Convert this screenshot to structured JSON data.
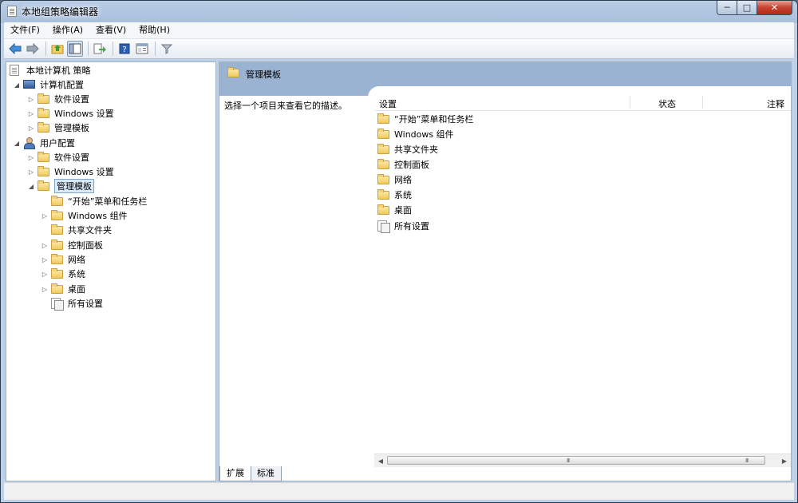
{
  "window": {
    "title": "本地组策略编辑器"
  },
  "menu": [
    "文件(F)",
    "操作(A)",
    "查看(V)",
    "帮助(H)"
  ],
  "toolbar": [
    "back-arrow-icon",
    "forward-arrow-icon",
    "up-folder-icon",
    "show-hide-tree-icon",
    "export-list-icon",
    "help-icon",
    "properties-icon",
    "filter-icon"
  ],
  "tree": {
    "root": "本地计算机 策略",
    "computer_config": "计算机配置",
    "computer_children": [
      "软件设置",
      "Windows 设置",
      "管理模板"
    ],
    "user_config": "用户配置",
    "user_children": [
      "软件设置",
      "Windows 设置",
      "管理模板"
    ],
    "admin_templates_children": [
      "“开始”菜单和任务栏",
      "Windows 组件",
      "共享文件夹",
      "控制面板",
      "网络",
      "系统",
      "桌面",
      "所有设置"
    ]
  },
  "right_pane": {
    "header_title": "管理模板",
    "description": "选择一个项目来查看它的描述。",
    "columns": {
      "setting": "设置",
      "status": "状态",
      "note": "注释"
    },
    "items": [
      "“开始”菜单和任务栏",
      "Windows 组件",
      "共享文件夹",
      "控制面板",
      "网络",
      "系统",
      "桌面",
      "所有设置"
    ]
  },
  "tabs": {
    "expand": "扩展",
    "standard": "标准"
  },
  "scrollbar": {
    "grip": "III"
  }
}
